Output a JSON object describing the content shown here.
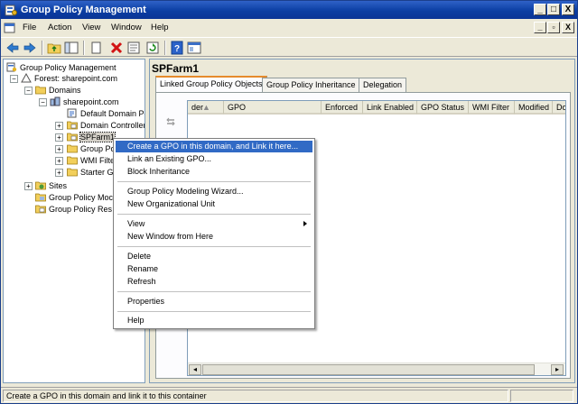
{
  "window": {
    "title": "Group Policy Management",
    "caption_buttons": {
      "minimize": "_",
      "maximize": "□",
      "close": "X"
    },
    "mdi_buttons": {
      "minimize": "_",
      "restore": "▫",
      "close": "X"
    }
  },
  "menubar": [
    "File",
    "Action",
    "View",
    "Window",
    "Help"
  ],
  "toolbar": [
    "back-icon",
    "forward-icon",
    "up-folder-icon",
    "show-hide-tree-icon",
    "copy-icon",
    "delete-icon",
    "properties-icon",
    "refresh-icon",
    "help-icon",
    "console-icon"
  ],
  "tree": {
    "items": [
      {
        "label": "Group Policy Management",
        "icon": "gpm-icon"
      },
      {
        "label": "Forest: sharepoint.com",
        "icon": "forest-icon"
      },
      {
        "label": "Domains",
        "icon": "folder-icon"
      },
      {
        "label": "sharepoint.com",
        "icon": "domain-icon"
      },
      {
        "label": "Default Domain Po",
        "icon": "gpo-link-icon"
      },
      {
        "label": "Domain Controller",
        "icon": "ou-icon"
      },
      {
        "label": "SPFarm1",
        "icon": "ou-icon"
      },
      {
        "label": "Group Po",
        "icon": "folder-icon"
      },
      {
        "label": "WMI Filte",
        "icon": "folder-icon"
      },
      {
        "label": "Starter G",
        "icon": "folder-icon"
      },
      {
        "label": "Sites",
        "icon": "sites-icon"
      },
      {
        "label": "Group Policy Moc",
        "icon": "modeling-icon"
      },
      {
        "label": "Group Policy Res",
        "icon": "results-icon"
      }
    ]
  },
  "right_pane": {
    "title": "SPFarm1",
    "tabs": [
      "Linked Group Policy Objects",
      "Group Policy Inheritance",
      "Delegation"
    ],
    "active_tab": 0,
    "columns": [
      "der",
      "GPO",
      "Enforced",
      "Link Enabled",
      "GPO Status",
      "WMI Filter",
      "Modified",
      "Do"
    ],
    "sort_indicator": "▲"
  },
  "context_menu": {
    "groups": [
      [
        "Create a GPO in this domain, and Link it here...",
        "Link an Existing GPO...",
        "Block Inheritance"
      ],
      [
        "Group Policy Modeling Wizard...",
        "New Organizational Unit"
      ],
      [
        "View",
        "New Window from Here"
      ],
      [
        "Delete",
        "Rename",
        "Refresh"
      ],
      [
        "Properties"
      ],
      [
        "Help"
      ]
    ],
    "highlighted": "Create a GPO in this domain, and Link it here...",
    "submenu": "View"
  },
  "statusbar": {
    "text": "Create a GPO in this domain and link it to this container"
  },
  "colors": {
    "titlebar": "#0b3ea3",
    "highlight": "#316ac5",
    "tab_accent": "#e68b2c"
  }
}
